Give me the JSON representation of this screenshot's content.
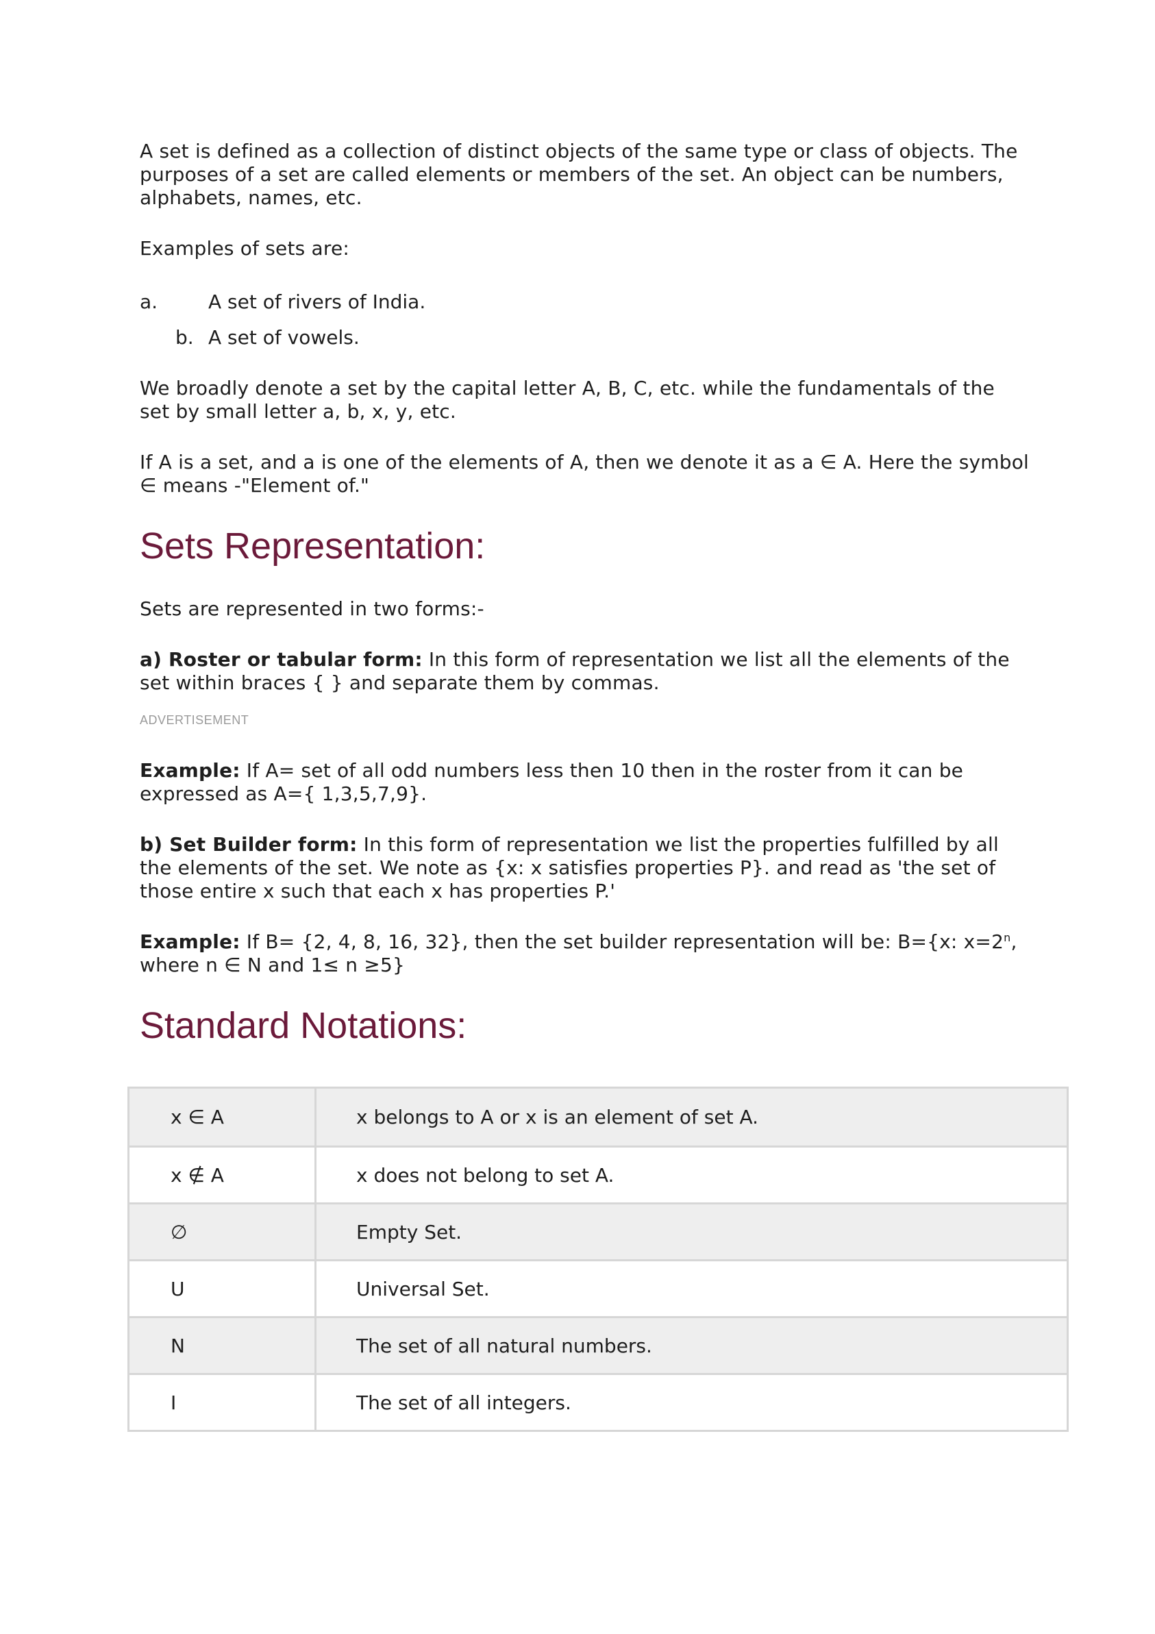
{
  "intro": "A set is defined as a collection of distinct objects of the same type or class of objects. The purposes of a set are called elements or members of the set. An object can be numbers, alphabets, names, etc.",
  "examples_lead": "Examples of sets are:",
  "examples": [
    {
      "marker": "a.",
      "text": "A set of rivers of India."
    },
    {
      "marker": "b.",
      "text": "A set of vowels."
    }
  ],
  "denote_para": "We broadly denote a set by the capital letter A, B, C, etc. while the fundamentals of the set by small letter a, b, x, y, etc.",
  "element_para": "If A is a set, and a is one of the elements of A, then we denote it as a ∈ A. Here the symbol ∈ means -\"Element of.\"",
  "heading_representation": "Sets Representation:",
  "forms_lead": "Sets are represented in two forms:-",
  "roster": {
    "label": "a) Roster or tabular form:",
    "text": " In this form of representation we list all the elements of the set within braces { } and separate them by commas."
  },
  "advertisement": "ADVERTISEMENT",
  "example1": {
    "label": "Example:",
    "text": " If A= set of all odd numbers less then 10 then in the roster from it can be expressed as A={ 1,3,5,7,9}."
  },
  "builder": {
    "label": "b) Set Builder form:",
    "text": " In this form of representation we list the properties fulfilled by all the elements of the set. We note as {x: x satisfies properties P}. and read as 'the set of those entire x such that each x has properties P.'"
  },
  "example2": {
    "label": "Example:",
    "text_before": " If B= {2, 4, 8, 16, 32}, then the set builder representation will be: B={x: x=2",
    "sup": "n",
    "text_after": ", where n ∈ N and 1≤ n ≥5}"
  },
  "heading_notations": "Standard Notations:",
  "notations": [
    {
      "symbol": "x ∈ A",
      "meaning": "x belongs to A or x is an element of set A."
    },
    {
      "symbol": "x ∉ A",
      "meaning": "x does not belong to set A."
    },
    {
      "symbol": "∅",
      "meaning": "Empty Set."
    },
    {
      "symbol": "U",
      "meaning": "Universal Set."
    },
    {
      "symbol": "N",
      "meaning": "The set of all natural numbers."
    },
    {
      "symbol": "I",
      "meaning": "The set of all integers."
    }
  ]
}
